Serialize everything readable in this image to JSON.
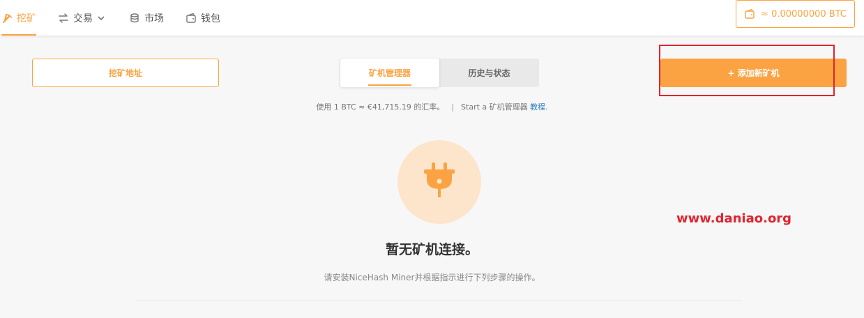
{
  "nav": {
    "items": [
      {
        "label": "挖矿",
        "icon": "pickaxe-icon",
        "active": true
      },
      {
        "label": "交易",
        "icon": "swap-arrows-icon",
        "active": false
      },
      {
        "label": "市场",
        "icon": "coins-icon",
        "active": false
      },
      {
        "label": "钱包",
        "icon": "wallet-icon",
        "active": false
      }
    ],
    "wallet_balance": "≈ 0.00000000 BTC"
  },
  "actions": {
    "mining_address_label": "挖矿地址",
    "add_miner_label": "+ 添加新矿机"
  },
  "tabs": [
    {
      "label": "矿机管理器",
      "active": true
    },
    {
      "label": "历史与状态",
      "active": false
    }
  ],
  "info": {
    "rate_text": "使用 1 BTC ≈ €41,715.19 的汇率。",
    "separator": "|",
    "start_text": "Start a 矿机管理器 ",
    "tutorial_link": "教程",
    "period": "."
  },
  "empty_state": {
    "icon": "plug-icon",
    "title": "暂无矿机连接。",
    "description": "请安装NiceHash Miner并根据指示进行下列步骤的操作。"
  },
  "watermark": "www.daniao.org",
  "colors": {
    "accent": "#fba342",
    "accent_light": "#fde5cc",
    "highlight_border": "#e0242e",
    "link": "#2a7fbf"
  }
}
